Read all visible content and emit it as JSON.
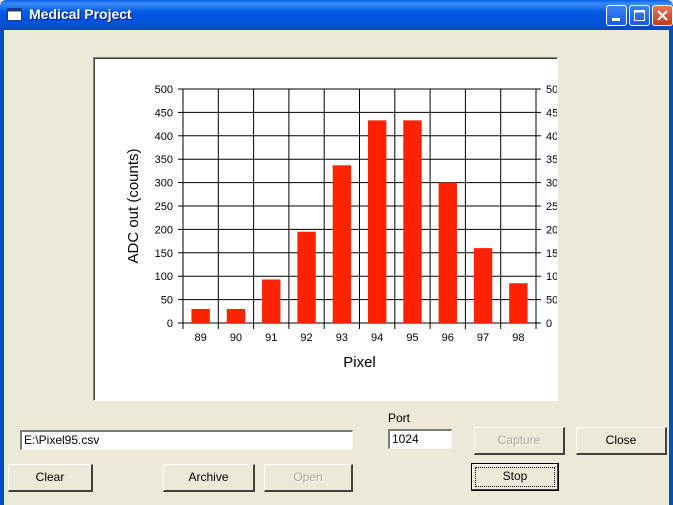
{
  "window": {
    "title": "Medical Project"
  },
  "chart_data": {
    "type": "bar",
    "title": "",
    "xlabel": "Pixel",
    "ylabel": "ADC out (counts)",
    "categories": [
      "89",
      "90",
      "91",
      "92",
      "93",
      "94",
      "95",
      "96",
      "97",
      "98"
    ],
    "values": [
      30,
      30,
      93,
      195,
      337,
      433,
      433,
      300,
      160,
      85
    ],
    "ylim": [
      0,
      500
    ],
    "yticks": [
      0,
      50,
      100,
      150,
      200,
      250,
      300,
      350,
      400,
      450,
      500
    ],
    "grid": true,
    "bar_color": "#FF2200"
  },
  "file_path": "E:\\Pixel95.csv",
  "port": {
    "label": "Port",
    "value": "1024"
  },
  "buttons": {
    "capture": "Capture",
    "close": "Close",
    "clear": "Clear",
    "archive": "Archive",
    "open": "Open",
    "stop": "Stop"
  }
}
